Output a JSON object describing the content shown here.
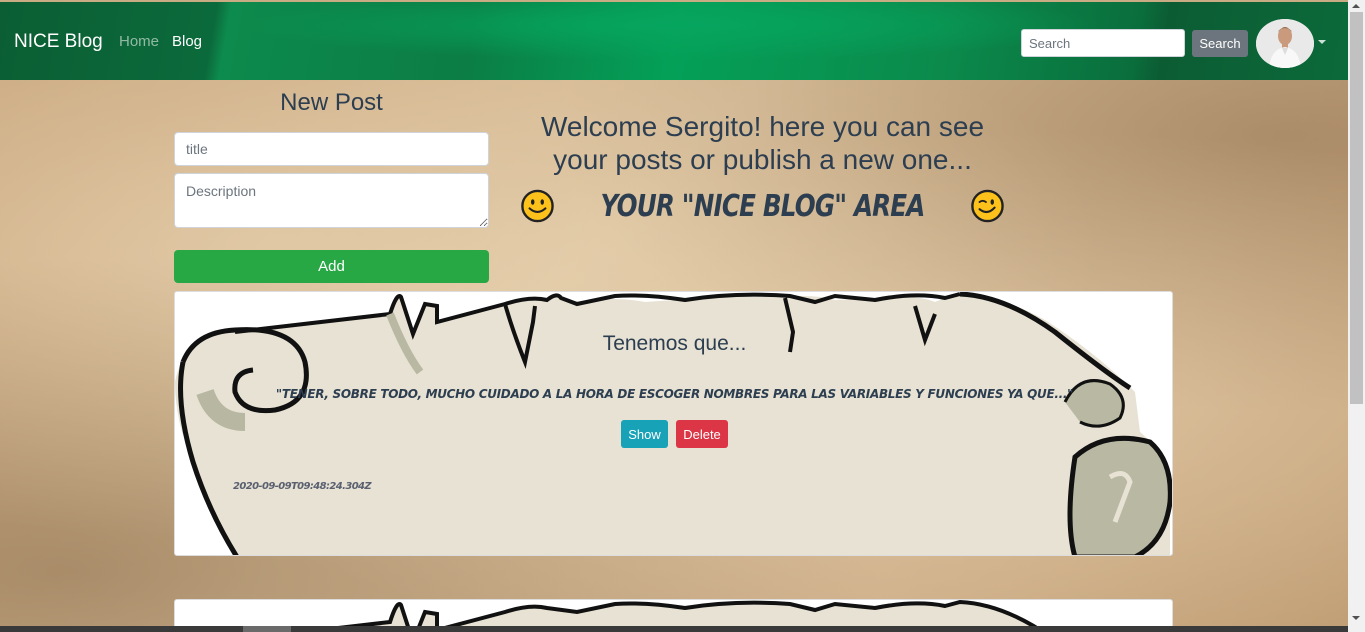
{
  "navbar": {
    "brand": "NICE Blog",
    "links": [
      {
        "label": "Home"
      },
      {
        "label": "Blog"
      }
    ],
    "search_placeholder": "Search",
    "search_button": "Search"
  },
  "new_post": {
    "heading": "New Post",
    "title_placeholder": "title",
    "description_placeholder": "Description",
    "add_button": "Add"
  },
  "welcome": {
    "line1": "Welcome Sergito! here you can see",
    "line2": "your posts or publish a new one...",
    "area_text": "YOUR \"NICE BLOG\" AREA"
  },
  "posts": [
    {
      "title": "Tenemos que...",
      "description": "\"TENER, SOBRE TODO, MUCHO CUIDADO A LA HORA DE ESCOGER NOMBRES PARA LAS VARIABLES Y FUNCIONES YA QUE...\"",
      "show_button": "Show",
      "delete_button": "Delete",
      "date": "2020-09-09T09:48:24.304Z"
    }
  ],
  "colors": {
    "navbar": "#04a058",
    "add": "#28a745",
    "show": "#17a2b8",
    "delete": "#dc3545",
    "search_button": "#6c757d",
    "text": "#2c3e50"
  },
  "icons": [
    "smile-emoji-icon",
    "wink-emoji-icon",
    "user-avatar",
    "caret-down-icon"
  ]
}
